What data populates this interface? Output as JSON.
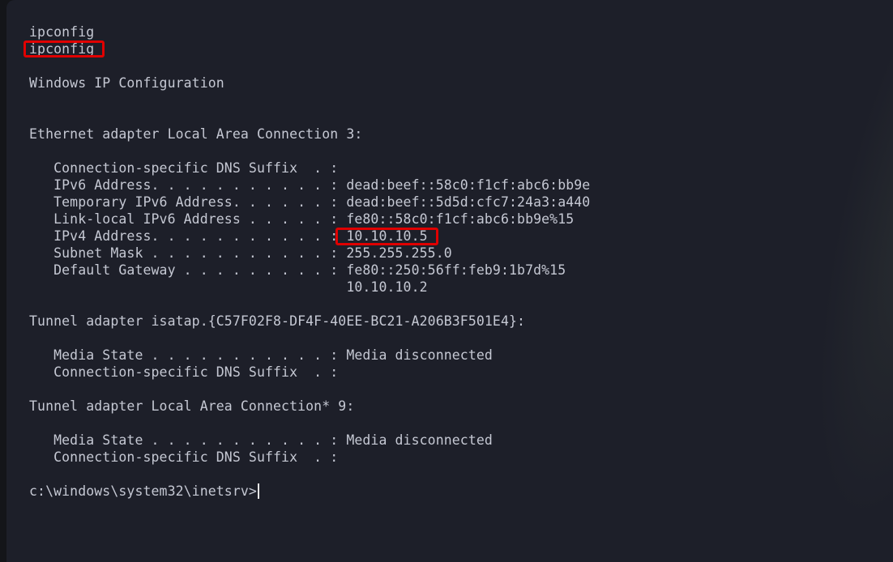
{
  "terminal": {
    "lines": [
      "ipconfig",
      "ipconfig",
      "",
      "Windows IP Configuration",
      "",
      "",
      "Ethernet adapter Local Area Connection 3:",
      "",
      "   Connection-specific DNS Suffix  . :",
      "   IPv6 Address. . . . . . . . . . . : dead:beef::58c0:f1cf:abc6:bb9e",
      "   Temporary IPv6 Address. . . . . . : dead:beef::5d5d:cfc7:24a3:a440",
      "   Link-local IPv6 Address . . . . . : fe80::58c0:f1cf:abc6:bb9e%15",
      "   IPv4 Address. . . . . . . . . . . : 10.10.10.5",
      "   Subnet Mask . . . . . . . . . . . : 255.255.255.0",
      "   Default Gateway . . . . . . . . . : fe80::250:56ff:feb9:1b7d%15",
      "                                       10.10.10.2",
      "",
      "Tunnel adapter isatap.{C57F02F8-DF4F-40EE-BC21-A206B3F501E4}:",
      "",
      "   Media State . . . . . . . . . . . : Media disconnected",
      "   Connection-specific DNS Suffix  . :",
      "",
      "Tunnel adapter Local Area Connection* 9:",
      "",
      "   Media State . . . . . . . . . . . : Media disconnected",
      "   Connection-specific DNS Suffix  . :",
      "",
      "c:\\windows\\system32\\inetsrv>"
    ]
  },
  "colors": {
    "background": "#1d1f29",
    "text": "#c5c8d3",
    "highlight": "#e00000"
  }
}
